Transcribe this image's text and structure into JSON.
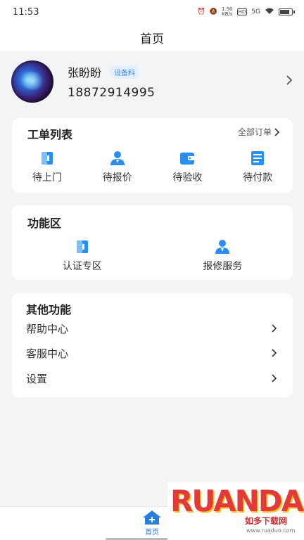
{
  "status_bar": {
    "time": "11:53",
    "net_speed_top": "1.90",
    "net_speed_bottom": "KB/s",
    "hd": "HD",
    "signal": "5G"
  },
  "nav": {
    "title": "首页"
  },
  "profile": {
    "name": "张盼盼",
    "role": "设备科",
    "phone": "18872914995"
  },
  "orders": {
    "title": "工单列表",
    "all_orders": "全部订单",
    "items": [
      {
        "label": "待上门",
        "icon": "door-icon"
      },
      {
        "label": "待报价",
        "icon": "person-icon"
      },
      {
        "label": "待验收",
        "icon": "wallet-icon"
      },
      {
        "label": "待付款",
        "icon": "form-icon"
      }
    ]
  },
  "func": {
    "title": "功能区",
    "items": [
      {
        "label": "认证专区",
        "icon": "certificate-icon"
      },
      {
        "label": "报修服务",
        "icon": "person-icon"
      }
    ]
  },
  "other": {
    "title": "其他功能",
    "items": [
      {
        "label": "帮助中心"
      },
      {
        "label": "客服中心"
      },
      {
        "label": "设置"
      }
    ]
  },
  "tabbar": {
    "home_label": "首页"
  },
  "watermark": {
    "logo": "RUANDAO",
    "sub": "如多下载网",
    "url": "www.ruaduo.com"
  },
  "colors": {
    "accent": "#2a7de1",
    "icon_blue": "#2a8ef0",
    "background": "#f3f4f6"
  }
}
